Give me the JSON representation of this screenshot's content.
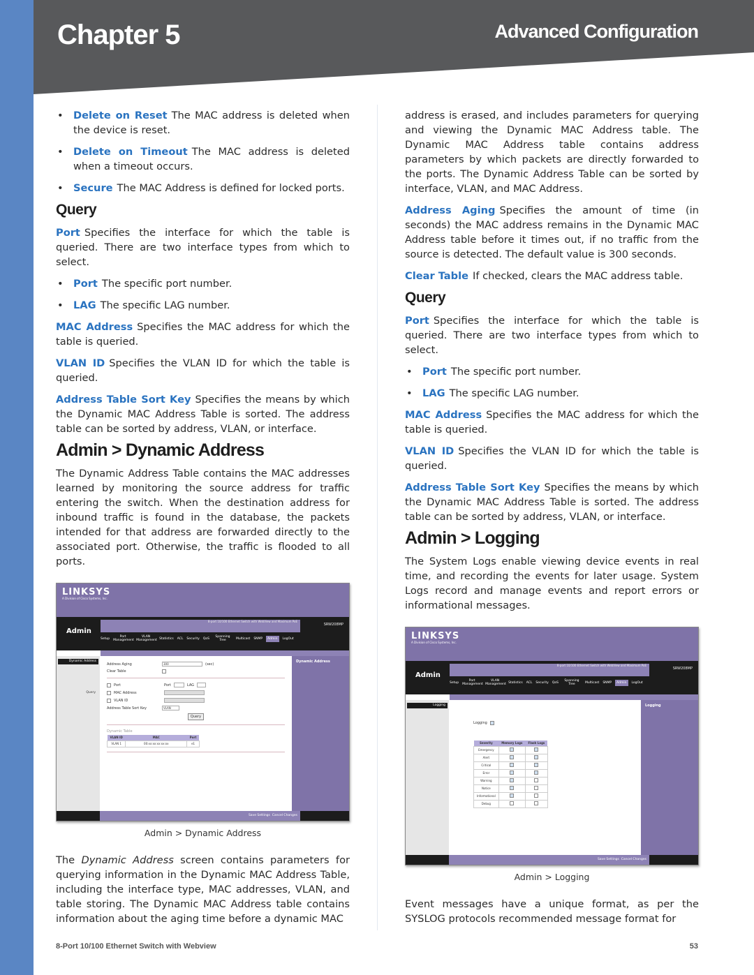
{
  "header": {
    "chapter": "Chapter 5",
    "section": "Advanced Configuration",
    "colors": {
      "bar": "#58595b",
      "sidebar": "#5a86c4",
      "term": "#2a73c0"
    }
  },
  "left": {
    "bullets_top": [
      {
        "term": "Delete on Reset",
        "text": "The MAC address is deleted when the device is reset."
      },
      {
        "term": "Delete on Timeout",
        "text": "The MAC address is deleted when a timeout occurs."
      },
      {
        "term": "Secure",
        "text": "The MAC Address is defined for locked ports."
      }
    ],
    "query_heading": "Query",
    "port": {
      "term": "Port",
      "text": "Specifies the interface for which the table is queried. There are two interface types from which to select."
    },
    "port_bullets": [
      {
        "term": "Port",
        "text": "The specific port number."
      },
      {
        "term": "LAG",
        "text": "The specific LAG number."
      }
    ],
    "mac": {
      "term": "MAC Address",
      "text": "Specifies the MAC address for which the table is queried."
    },
    "vlan": {
      "term": "VLAN ID",
      "text": "Specifies the VLAN ID for which the table is queried."
    },
    "sortkey": {
      "term": "Address Table Sort Key",
      "text": "Specifies the means by which the Dynamic MAC Address Table is sorted. The address table can be sorted by address, VLAN, or interface."
    },
    "dyn_heading": "Admin > Dynamic Address",
    "dyn_intro": "The Dynamic Address Table contains the MAC addresses learned by monitoring the source address for traffic entering the switch. When the destination address for inbound traffic is found in the database, the packets intended for that address are forwarded directly to the associated port. Otherwise, the traffic is flooded to all ports.",
    "dyn_caption": "Admin > Dynamic Address",
    "dyn_para_pre": "The ",
    "dyn_para_em": "Dynamic Address",
    "dyn_para_post": " screen contains parameters for querying information in the Dynamic MAC Address Table, including the interface type, MAC addresses, VLAN, and table storing. The Dynamic MAC Address table contains information about the aging time before a dynamic MAC"
  },
  "right": {
    "cont": "address is erased, and includes parameters for querying and viewing the Dynamic MAC Address table. The Dynamic MAC Address table contains address parameters by which packets are directly forwarded to the ports. The Dynamic Address Table can be sorted by interface, VLAN, and MAC Address.",
    "aging": {
      "term": "Address Aging",
      "text": "Specifies the amount of time (in seconds) the MAC address remains in the Dynamic MAC Address table before it times out, if no traffic from the source is detected. The default value is 300 seconds."
    },
    "clear": {
      "term": "Clear Table",
      "text": "If checked, clears the MAC address table."
    },
    "query_heading": "Query",
    "port": {
      "term": "Port",
      "text": "Specifies the interface for which the table is queried. There are two interface types from which to select."
    },
    "port_bullets": [
      {
        "term": "Port",
        "text": "The specific port number."
      },
      {
        "term": "LAG",
        "text": "The specific LAG number."
      }
    ],
    "mac": {
      "term": "MAC Address",
      "text": "Specifies the MAC address for which the table is queried."
    },
    "vlan": {
      "term": "VLAN ID",
      "text": "Specifies the VLAN ID for which the table is queried."
    },
    "sortkey": {
      "term": "Address Table Sort Key",
      "text": "Specifies the means by which the Dynamic MAC Address Table is sorted. The address table can be sorted by address, VLAN, or interface."
    },
    "log_heading": "Admin > Logging",
    "log_intro": "The System Logs enable viewing device events in real time, and recording the events for later usage. System Logs record and manage events and report errors or informational messages.",
    "log_caption": "Admin > Logging",
    "log_para": "Event messages have a unique format, as per the SYSLOG protocols recommended message format for"
  },
  "webui": {
    "logo": "LINKSYS",
    "logo_sub": "A Division of Cisco Systems, Inc.",
    "page_title": "Admin",
    "product": "8-port 10/100 Ethernet Switch with WebView and Maximum PoE",
    "model": "SRW208MP",
    "nav": [
      "Setup",
      "Port Management",
      "VLAN Management",
      "Statistics",
      "ACL",
      "Security",
      "QoS",
      "Spanning Tree",
      "Multicast",
      "SNMP",
      "Admin",
      "LogOut"
    ],
    "save": "Save Settings",
    "cancel": "Cancel Changes",
    "dynamic": {
      "side_item": "Dynamic Address",
      "side_query": "Query",
      "aging_label": "Address Aging",
      "aging_value": "300",
      "aging_unit": "(sec)",
      "clear_label": "Clear Table",
      "port_label": "Port",
      "port_opt": "Port",
      "lag_opt": "LAG",
      "mac_label": "MAC Address",
      "vlan_label": "VLAN ID",
      "sort_label": "Address Table Sort Key",
      "sort_value": "VLAN",
      "query_btn": "Query",
      "table_title": "Dynamic Table",
      "cols": [
        "VLAN ID",
        "MAC",
        "Port"
      ],
      "rows": [
        [
          "VLAN 1",
          "00:xx:xx:xx:xx:xx",
          "e1"
        ]
      ],
      "help_title": "Dynamic Address"
    },
    "logging": {
      "side_item": "Logging",
      "logging_label": "Logging",
      "cols": [
        "Severity",
        "Memory Logs",
        "Flash Logs"
      ],
      "rows": [
        {
          "sev": "Emergency",
          "mem": true,
          "flash": true
        },
        {
          "sev": "Alert",
          "mem": true,
          "flash": true
        },
        {
          "sev": "Critical",
          "mem": true,
          "flash": true
        },
        {
          "sev": "Error",
          "mem": true,
          "flash": true
        },
        {
          "sev": "Warning",
          "mem": true,
          "flash": false
        },
        {
          "sev": "Notice",
          "mem": true,
          "flash": false
        },
        {
          "sev": "Informational",
          "mem": true,
          "flash": false
        },
        {
          "sev": "Debug",
          "mem": false,
          "flash": false
        }
      ],
      "help_title": "Logging"
    }
  },
  "footer": {
    "product": "8-Port 10/100 Ethernet Switch with Webview",
    "page": "53"
  }
}
